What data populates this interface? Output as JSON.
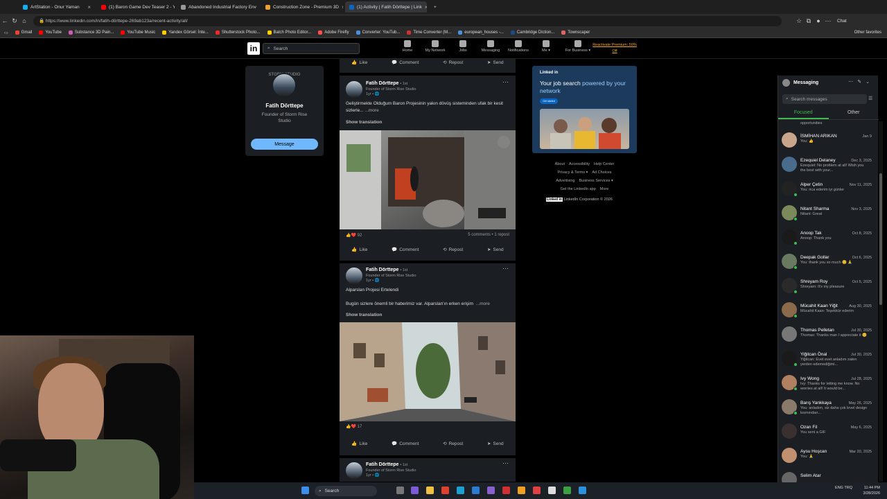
{
  "browser": {
    "tabs": [
      {
        "label": "ArtStation - Onur Yaman",
        "color": "#13aff0",
        "active": false
      },
      {
        "label": "(1) Baron Game Dev Teaser 2 - Yo",
        "color": "#ff0000",
        "active": false
      },
      {
        "label": "Abandoned Industrial Factory Env",
        "color": "#999999",
        "active": false
      },
      {
        "label": "Construction Zone - Premium 3D",
        "color": "#f0a030",
        "active": false
      },
      {
        "label": "(1) Activity | Fatih Dörttepe | Link",
        "color": "#0a66c2",
        "active": true
      }
    ],
    "url": "https://www.linkedin.com/in/fatih-dörttepe-269ab123a/recent-activity/all/",
    "bookmarks": [
      {
        "label": "Gmail",
        "color": "#ea4335"
      },
      {
        "label": "YouTube",
        "color": "#ff0000"
      },
      {
        "label": "Substance 3D Pain...",
        "color": "#d05bb0"
      },
      {
        "label": "YouTube Music",
        "color": "#ff0000"
      },
      {
        "label": "Yandex Görsel: İnte...",
        "color": "#ffcc00"
      },
      {
        "label": "Shutterstock Photo...",
        "color": "#ee2b24"
      },
      {
        "label": "Batch Photo Editor...",
        "color": "#ffd200"
      },
      {
        "label": "Adobe Firefly",
        "color": "#ff4c4c"
      },
      {
        "label": "Converter: YouTub...",
        "color": "#4a90d9"
      },
      {
        "label": "Time Converter (M...",
        "color": "#cc3333"
      },
      {
        "label": "european_houses -...",
        "color": "#4a90d9"
      },
      {
        "label": "Cambridge Diction...",
        "color": "#1a4a8a"
      },
      {
        "label": "Townscaper",
        "color": "#e06666"
      }
    ],
    "other_favorites": "Other favorites",
    "chat_label": "Chat"
  },
  "linkedin": {
    "logo": "in",
    "search_placeholder": "Search",
    "nav": [
      {
        "label": "Home",
        "icon": "home-icon"
      },
      {
        "label": "My Network",
        "icon": "network-icon"
      },
      {
        "label": "Jobs",
        "icon": "jobs-icon"
      },
      {
        "label": "Messaging",
        "icon": "messaging-icon"
      },
      {
        "label": "Notifications",
        "icon": "bell-icon"
      },
      {
        "label": "Me ▾",
        "icon": "avatar-icon"
      },
      {
        "label": "For Business ▾",
        "icon": "grid-icon"
      }
    ],
    "premium": "Reactivate Premium: 50% Off"
  },
  "profile": {
    "banner": "STORM STUDIO",
    "name": "Fatih Dörttepe",
    "title": "Founder of Storm Rise Studio",
    "message_button": "Message"
  },
  "feed": {
    "top_actions": [
      "Like",
      "Comment",
      "Repost",
      "Send"
    ],
    "posts": [
      {
        "author": "Fatih Dörttepe",
        "degree": "• 1st",
        "headline": "Founder of Storm Rise Studio",
        "time": "1yr • 🌐",
        "text": "Geliştirmekte Olduğum Baron Projesinin yakın dövüş sisteminden ufak bir kesit sizlerle...",
        "more": "...more",
        "translate": "Show translation",
        "reactions": "92",
        "comments": "5 comments • 1 repost",
        "actions": [
          "Like",
          "Comment",
          "Repost",
          "Send"
        ]
      },
      {
        "author": "Fatih Dörttepe",
        "degree": "• 1st",
        "headline": "Founder of Storm Rise Studio",
        "time": "1yr • 🌐",
        "title": "Alparslan Projesi Ertelendi",
        "text": "Bugün sizlere önemli bir haberimiz var. Alparslan'ın erken erişim",
        "more": "...more",
        "translate": "Show translation",
        "reactions": "17",
        "actions": [
          "Like",
          "Comment",
          "Repost",
          "Send"
        ]
      },
      {
        "author": "Fatih Dörttepe",
        "degree": "• 1st",
        "headline": "Founder of Storm Rise Studio",
        "time": "1yr • 🌐"
      }
    ]
  },
  "ad": {
    "brand": "Linked in",
    "headline_a": "Your job search ",
    "headline_b": "powered by your network",
    "button": "Get started"
  },
  "footer": {
    "links": [
      "About",
      "Accessibility",
      "Help Center",
      "Privacy & Terms ▾",
      "Ad Choices",
      "Advertising",
      "Business Services ▾",
      "Get the LinkedIn app",
      "More"
    ],
    "corp_logo": "Linked in",
    "corp": "LinkedIn Corporation © 2026"
  },
  "messaging": {
    "title": "Messaging",
    "search_placeholder": "Search messages",
    "tab_focused": "Focused",
    "tab_other": "Other",
    "partial_top": "opportunities",
    "conversations": [
      {
        "name": "İSMİHAN ARIKAN",
        "date": "Jan 9",
        "preview": "You: 👍",
        "color": "#c9a58c",
        "online": false
      },
      {
        "name": "Ezequiel Delaney",
        "date": "Dec 3, 2025",
        "preview": "Ezequiel: No problem at all! Wish you the best with your...",
        "color": "#4a6c8c",
        "online": false
      },
      {
        "name": "Alper Çetin",
        "date": "Nov 11, 2025",
        "preview": "You: rica ederim iyi günler",
        "color": "#222222",
        "online": true
      },
      {
        "name": "Nitant Sharma",
        "date": "Nov 3, 2025",
        "preview": "Nitant: Great",
        "color": "#7a8a5a",
        "online": true
      },
      {
        "name": "Anoop Tak",
        "date": "Oct 8, 2025",
        "preview": "Anoop: Thank you",
        "color": "#1a1a1a",
        "online": true
      },
      {
        "name": "Deepak Gollar",
        "date": "Oct 6, 2025",
        "preview": "You: thank you so much 😊 🙏",
        "color": "#6a7a60",
        "online": true
      },
      {
        "name": "Shreyam Roy",
        "date": "Oct 5, 2025",
        "preview": "Shreyam: It's my pleasure",
        "color": "#2a2a2a",
        "online": true
      },
      {
        "name": "Mücahit Kaan Yiğit",
        "date": "Aug 30, 2025",
        "preview": "Mücahit Kaan: Teşekkür ederim",
        "color": "#8a6a4a",
        "online": true
      },
      {
        "name": "Thomas Pelletan",
        "date": "Jul 30, 2025",
        "preview": "Thomas: Thanks man I appreciate it 😊",
        "color": "#777777",
        "online": false
      },
      {
        "name": "Yiğitcan Önal",
        "date": "Jul 30, 2025",
        "preview": "Yiğitcan: Evet evet anladım zaten yerden edemediğimi...",
        "color": "#1a1a1a",
        "online": true
      },
      {
        "name": "Ivy Wong",
        "date": "Jul 28, 2025",
        "preview": "Ivy: Thanks for letting me know. No worries at all! It would be...",
        "color": "#b08060",
        "online": true
      },
      {
        "name": "Barış Yankkaya",
        "date": "May 26, 2025",
        "preview": "You: anladım, siz daha çok level design kısmından...",
        "color": "#8a7a6a",
        "online": true
      },
      {
        "name": "Ozan Fil",
        "date": "May 6, 2025",
        "preview": "You sent a GIF",
        "color": "#3a3030",
        "online": false
      },
      {
        "name": "Aysu Hoşcan",
        "date": "Mar 20, 2025",
        "preview": "You: 🙏",
        "color": "#c09070",
        "online": false
      },
      {
        "name": "Selim Atar",
        "date": "",
        "preview": "",
        "color": "#666666",
        "online": false
      }
    ]
  },
  "taskbar": {
    "search": "Search",
    "lang": "ENG TRQ",
    "time": "11:44 PM",
    "date": "3/28/2026"
  }
}
